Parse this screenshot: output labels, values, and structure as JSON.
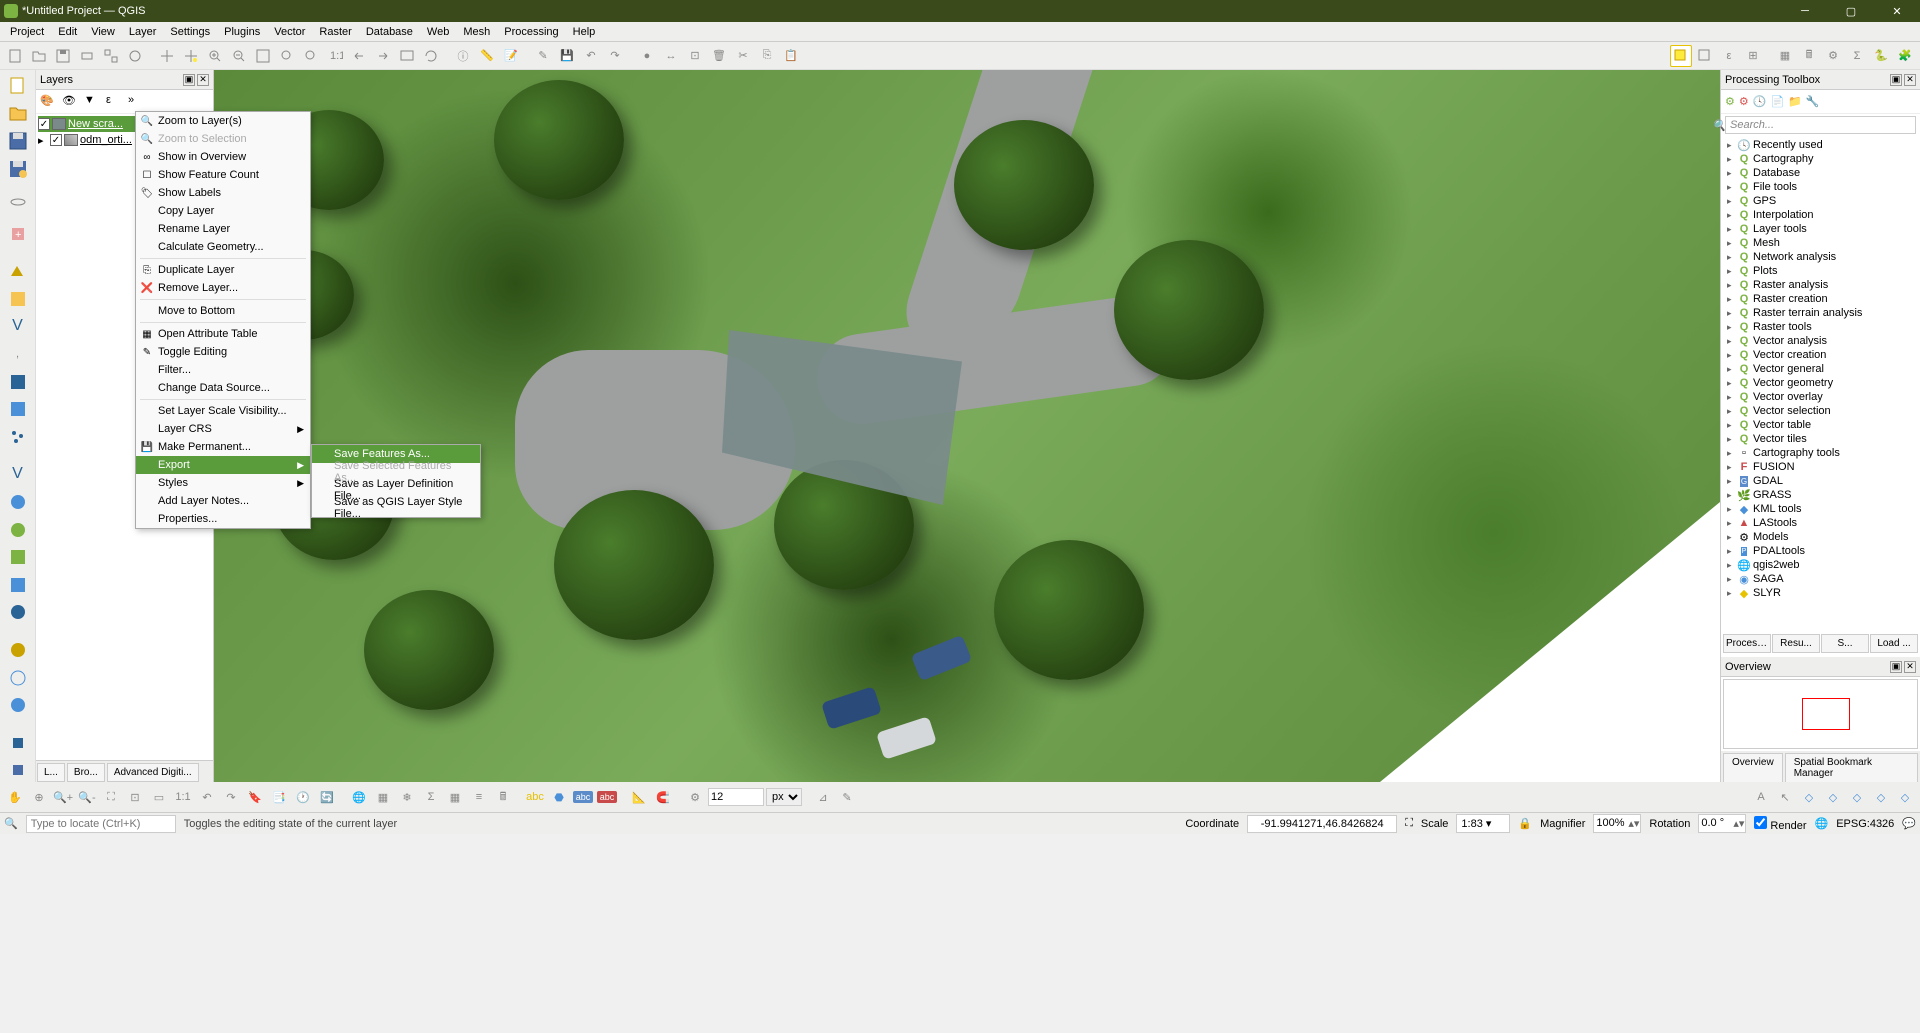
{
  "titlebar": {
    "title": "*Untitled Project — QGIS"
  },
  "menubar": {
    "items": [
      "Project",
      "Edit",
      "View",
      "Layer",
      "Settings",
      "Plugins",
      "Vector",
      "Raster",
      "Database",
      "Web",
      "Mesh",
      "Processing",
      "Help"
    ]
  },
  "layers_panel": {
    "title": "Layers",
    "tabs": [
      "L...",
      "Bro...",
      "Advanced Digiti..."
    ],
    "items": [
      {
        "checked": true,
        "label": "New scra...",
        "selected": true
      },
      {
        "checked": true,
        "label": "odm_orti...",
        "selected": false
      }
    ]
  },
  "context_menu": {
    "items": [
      {
        "label": "Zoom to Layer(s)",
        "icon": "zoom"
      },
      {
        "label": "Zoom to Selection",
        "icon": "zoom",
        "disabled": true
      },
      {
        "label": "Show in Overview",
        "icon": "link"
      },
      {
        "label": "Show Feature Count",
        "icon": "checkbox"
      },
      {
        "label": "Show Labels",
        "icon": "tag"
      },
      {
        "label": "Copy Layer"
      },
      {
        "label": "Rename Layer"
      },
      {
        "label": "Calculate Geometry..."
      },
      {
        "sep": true
      },
      {
        "label": "Duplicate Layer",
        "icon": "dup"
      },
      {
        "label": "Remove Layer...",
        "icon": "remove"
      },
      {
        "sep": true
      },
      {
        "label": "Move to Bottom"
      },
      {
        "sep": true
      },
      {
        "label": "Open Attribute Table",
        "icon": "table"
      },
      {
        "label": "Toggle Editing",
        "icon": "pencil"
      },
      {
        "label": "Filter..."
      },
      {
        "label": "Change Data Source..."
      },
      {
        "sep": true
      },
      {
        "label": "Set Layer Scale Visibility..."
      },
      {
        "label": "Layer CRS",
        "submenu": true
      },
      {
        "label": "Make Permanent...",
        "icon": "save"
      },
      {
        "label": "Export",
        "submenu": true,
        "highlighted": true
      },
      {
        "label": "Styles",
        "submenu": true
      },
      {
        "label": "Add Layer Notes..."
      },
      {
        "label": "Properties..."
      }
    ]
  },
  "export_submenu": {
    "items": [
      {
        "label": "Save Features As...",
        "highlighted": true
      },
      {
        "label": "Save Selected Features As...",
        "disabled": true
      },
      {
        "label": "Save as Layer Definition File..."
      },
      {
        "label": "Save as QGIS Layer Style File..."
      }
    ]
  },
  "processing_panel": {
    "title": "Processing Toolbox",
    "search_placeholder": "Search...",
    "tree": [
      {
        "label": "Recently used",
        "icon": "clock"
      },
      {
        "label": "Cartography",
        "icon": "Q"
      },
      {
        "label": "Database",
        "icon": "Q"
      },
      {
        "label": "File tools",
        "icon": "Q"
      },
      {
        "label": "GPS",
        "icon": "Q"
      },
      {
        "label": "Interpolation",
        "icon": "Q"
      },
      {
        "label": "Layer tools",
        "icon": "Q"
      },
      {
        "label": "Mesh",
        "icon": "Q"
      },
      {
        "label": "Network analysis",
        "icon": "Q"
      },
      {
        "label": "Plots",
        "icon": "Q"
      },
      {
        "label": "Raster analysis",
        "icon": "Q"
      },
      {
        "label": "Raster creation",
        "icon": "Q"
      },
      {
        "label": "Raster terrain analysis",
        "icon": "Q"
      },
      {
        "label": "Raster tools",
        "icon": "Q"
      },
      {
        "label": "Vector analysis",
        "icon": "Q"
      },
      {
        "label": "Vector creation",
        "icon": "Q"
      },
      {
        "label": "Vector general",
        "icon": "Q"
      },
      {
        "label": "Vector geometry",
        "icon": "Q"
      },
      {
        "label": "Vector overlay",
        "icon": "Q"
      },
      {
        "label": "Vector selection",
        "icon": "Q"
      },
      {
        "label": "Vector table",
        "icon": "Q"
      },
      {
        "label": "Vector tiles",
        "icon": "Q"
      },
      {
        "label": "Cartography tools",
        "icon": "box"
      },
      {
        "label": "FUSION",
        "icon": "F"
      },
      {
        "label": "GDAL",
        "icon": "gdal"
      },
      {
        "label": "GRASS",
        "icon": "grass"
      },
      {
        "label": "KML tools",
        "icon": "kml"
      },
      {
        "label": "LAStools",
        "icon": "las"
      },
      {
        "label": "Models",
        "icon": "model"
      },
      {
        "label": "PDALtools",
        "icon": "pdal"
      },
      {
        "label": "qgis2web",
        "icon": "web"
      },
      {
        "label": "SAGA",
        "icon": "saga"
      },
      {
        "label": "SLYR",
        "icon": "slyr"
      }
    ],
    "buttons": [
      "Processin...",
      "Resu...",
      "S...",
      "Load ..."
    ]
  },
  "overview_panel": {
    "title": "Overview",
    "tabs": [
      "Overview",
      "Spatial Bookmark Manager"
    ]
  },
  "statusbar": {
    "locate_placeholder": "Type to locate (Ctrl+K)",
    "hint": "Toggles the editing state of the current layer",
    "coord_label": "Coordinate",
    "coord_value": "-91.9941271,46.8426824",
    "scale_label": "Scale",
    "scale_value": "1:83",
    "mag_label": "Magnifier",
    "mag_value": "100%",
    "rot_label": "Rotation",
    "rot_value": "0.0 °",
    "render_label": "Render",
    "crs": "EPSG:4326"
  },
  "snap": {
    "value": "12",
    "unit": "px"
  }
}
